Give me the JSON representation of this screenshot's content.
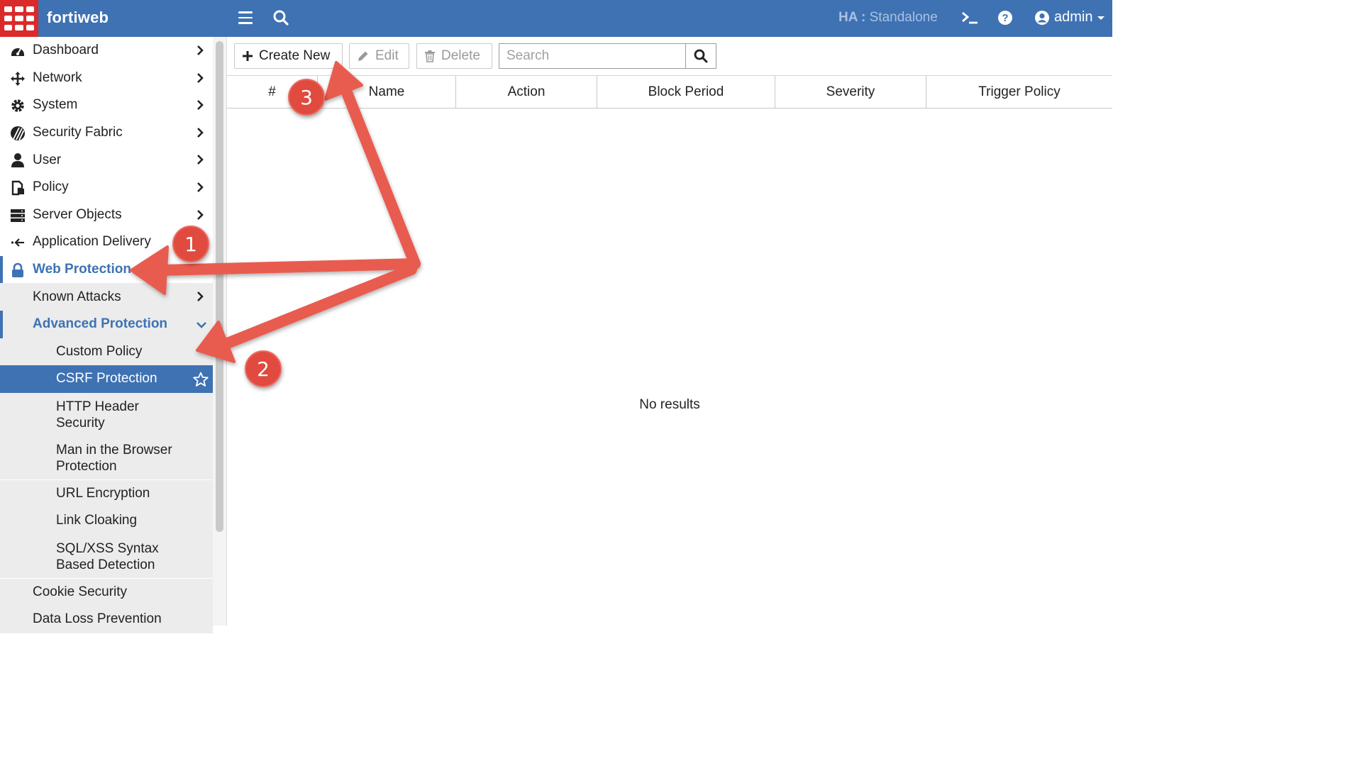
{
  "header": {
    "app_name": "fortiweb",
    "ha_label": "HA :",
    "ha_value": "Standalone",
    "user": "admin",
    "brand_color": "#3e72b3",
    "logo_color": "#da2a2a"
  },
  "sidebar": {
    "items": [
      {
        "label": "Dashboard",
        "icon": "dashboard-icon"
      },
      {
        "label": "Network",
        "icon": "network-icon"
      },
      {
        "label": "System",
        "icon": "gear-icon"
      },
      {
        "label": "Security Fabric",
        "icon": "security-fabric-icon"
      },
      {
        "label": "User",
        "icon": "user-icon"
      },
      {
        "label": "Policy",
        "icon": "policy-icon"
      },
      {
        "label": "Server Objects",
        "icon": "server-icon"
      },
      {
        "label": "Application Delivery",
        "icon": "application-delivery-icon"
      },
      {
        "label": "Web Protection",
        "icon": "lock-icon"
      },
      {
        "label": "Known Attacks"
      },
      {
        "label": "Advanced Protection"
      },
      {
        "label": "Custom Policy"
      },
      {
        "label": "CSRF Protection"
      },
      {
        "label": "HTTP Header Security"
      },
      {
        "label": "Man in the Browser Protection"
      },
      {
        "label": "URL Encryption"
      },
      {
        "label": "Link Cloaking"
      },
      {
        "label": "SQL/XSS Syntax Based Detection"
      },
      {
        "label": "Cookie Security"
      },
      {
        "label": "Data Loss Prevention"
      }
    ],
    "wrapped": {
      "http_line1": "HTTP Header",
      "http_line2": "Security",
      "mitb_line1": "Man in the Browser",
      "mitb_line2": "Protection",
      "sqlxss_line1": "SQL/XSS Syntax",
      "sqlxss_line2": "Based Detection"
    }
  },
  "toolbar": {
    "create_label": "Create New",
    "edit_label": "Edit",
    "delete_label": "Delete",
    "search_placeholder": "Search"
  },
  "table": {
    "columns": [
      "#",
      "Name",
      "Action",
      "Block Period",
      "Severity",
      "Trigger Policy"
    ],
    "empty_text": "No results"
  },
  "annotations": {
    "badges": [
      "1",
      "2",
      "3"
    ],
    "arrow_color": "#e85c4f"
  }
}
